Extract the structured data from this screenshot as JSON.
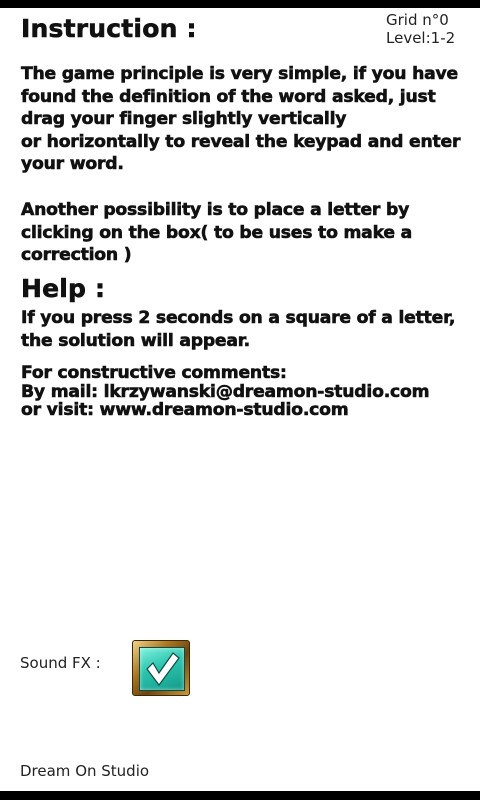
{
  "header": {
    "title": "Instruction :",
    "grid_label": "Grid n°0",
    "level_label": "Level:1-2"
  },
  "instructions": {
    "p1": [
      "The game principle is very simple, if you have",
      "found the definition of the word asked, just",
      "drag your finger slightly vertically",
      "or horizontally to reveal the keypad and enter",
      "your word."
    ],
    "p2": [
      "Another possibility is to place a letter by",
      "clicking on the box( to be uses to make a",
      "correction )"
    ]
  },
  "help": {
    "title": "Help :",
    "p1": [
      "If you press 2 seconds on a square of a letter,",
      "the solution will appear."
    ],
    "contact": [
      "For constructive comments:",
      "By mail: lkrzywanski@dreamon-studio.com",
      "or visit: www.dreamon-studio.com"
    ]
  },
  "settings": {
    "sound_label": "Sound FX :",
    "sound_enabled": true,
    "checkbox_icon": "checkmark-icon"
  },
  "footer": {
    "text": "Dream On Studio"
  },
  "colors": {
    "checkbox_fill": "#2cc3ad",
    "checkbox_frame": "#a8731f"
  }
}
